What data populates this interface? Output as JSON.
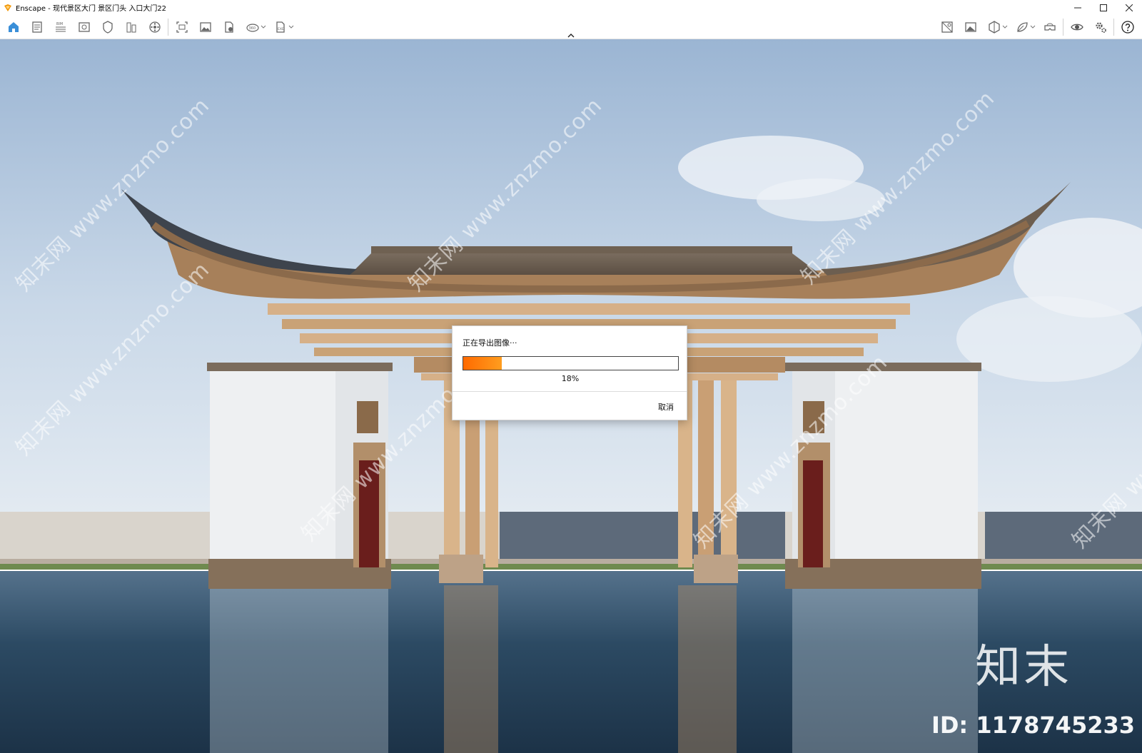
{
  "window": {
    "title": "Enscape - 现代景区大门 景区门头 入口大门22",
    "controls": [
      "minimize",
      "maximize",
      "close"
    ]
  },
  "toolbar": {
    "left_icons": [
      "home-icon",
      "project-notes-icon",
      "bim-icon",
      "views-icon",
      "safe-frame-icon",
      "site-context-icon",
      "video-icon",
      "screenshot-icon",
      "image-export-icon",
      "batch-render-icon",
      "panorama-360-icon",
      "exe-export-icon"
    ],
    "right_icons": [
      "asset-library-icon",
      "material-icon",
      "section-icon",
      "atmosphere-icon",
      "vr-headset-icon",
      "visibility-icon",
      "settings-icon",
      "help-icon"
    ],
    "bim_label": "BIM",
    "panorama_label": "360",
    "exe_label": "EXE"
  },
  "dialog": {
    "title": "正在导出图像···",
    "progress": 0.18,
    "progress_text": "18%",
    "cancel_label": "取消"
  },
  "watermark": {
    "text": "知末网 www.znzmo.com",
    "brand": "知末",
    "id_text": "ID: 1178745233"
  },
  "colors": {
    "progress_start": "#ff6a00",
    "progress_end": "#ff9d1f",
    "sky_top": "#9fb8d6",
    "water": "#1f3a52"
  }
}
